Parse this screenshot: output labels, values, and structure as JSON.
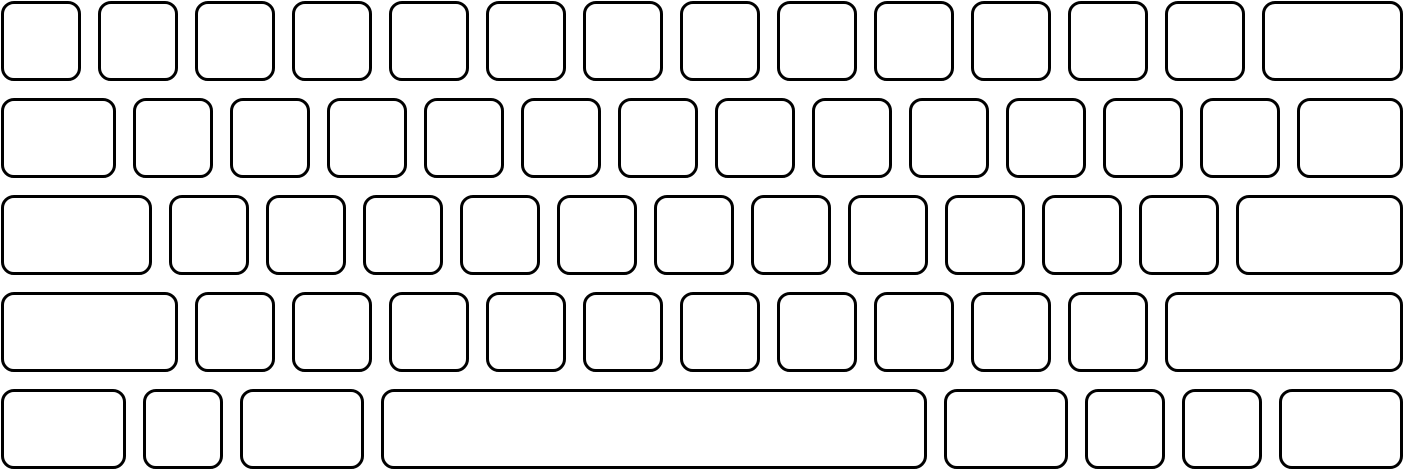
{
  "keyboard": {
    "rows": [
      {
        "keys": [
          "",
          "",
          "",
          "",
          "",
          "",
          "",
          "",
          "",
          "",
          "",
          "",
          "",
          ""
        ]
      },
      {
        "keys": [
          "",
          "",
          "",
          "",
          "",
          "",
          "",
          "",
          "",
          "",
          "",
          "",
          "",
          ""
        ]
      },
      {
        "keys": [
          "",
          "",
          "",
          "",
          "",
          "",
          "",
          "",
          "",
          "",
          "",
          "",
          ""
        ]
      },
      {
        "keys": [
          "",
          "",
          "",
          "",
          "",
          "",
          "",
          "",
          "",
          "",
          "",
          ""
        ]
      },
      {
        "keys": [
          "",
          "",
          "",
          "",
          "",
          "",
          "",
          ""
        ]
      }
    ]
  },
  "colors": {
    "key_fill": "#ffffff",
    "key_outline": "#000000",
    "background": "#ffffff"
  }
}
